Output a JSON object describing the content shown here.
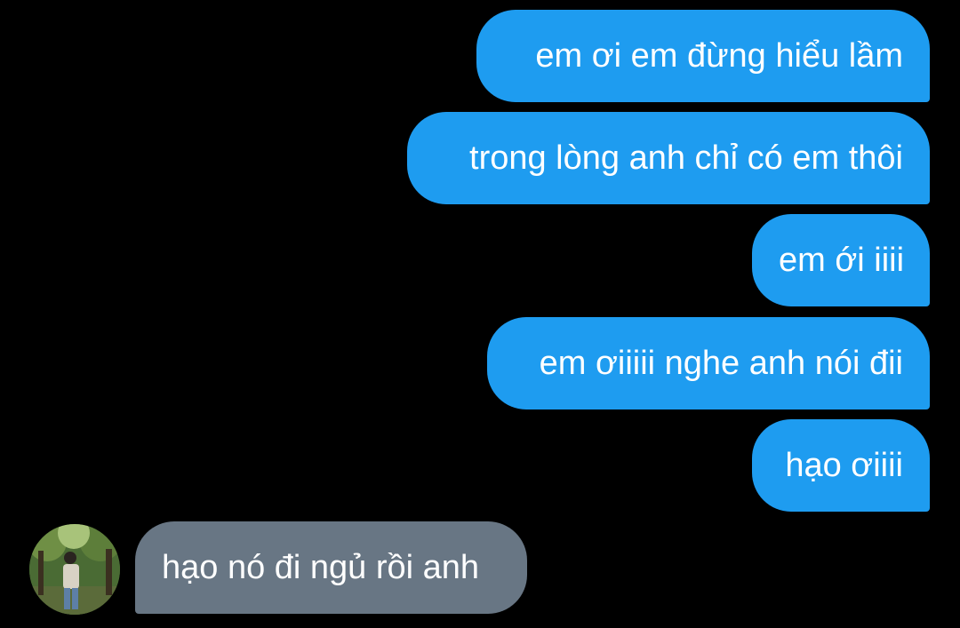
{
  "colors": {
    "background": "#000000",
    "sent_bubble": "#1e9cf0",
    "received_bubble": "#687684",
    "text": "#ffffff"
  },
  "messages": [
    {
      "sender": "me",
      "text": "em ơi em đừng hiểu lầm"
    },
    {
      "sender": "me",
      "text": "trong lòng anh chỉ có em thôi"
    },
    {
      "sender": "me",
      "text": "em ới iiii"
    },
    {
      "sender": "me",
      "text": "em ơiiiii nghe anh nói đii"
    },
    {
      "sender": "me",
      "text": "hạo ơiiii"
    },
    {
      "sender": "other",
      "text": "hạo nó đi ngủ rồi anh",
      "avatar": "contact-photo"
    }
  ]
}
